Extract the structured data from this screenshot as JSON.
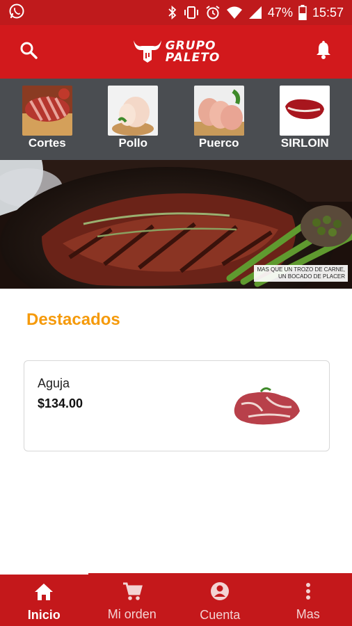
{
  "status_bar": {
    "battery": "47%",
    "time": "15:57",
    "icons": [
      "whatsapp-icon",
      "bluetooth-icon",
      "vibrate-icon",
      "alarm-icon",
      "wifi-icon",
      "signal-icon",
      "battery-icon"
    ]
  },
  "app_bar": {
    "logo_line1": "GRUPO",
    "logo_line2": "PALETO",
    "left_icon": "search-icon",
    "right_icon": "bell-icon"
  },
  "categories": [
    {
      "label": "Cortes"
    },
    {
      "label": "Pollo"
    },
    {
      "label": "Puerco"
    },
    {
      "label": "SIRLOIN"
    }
  ],
  "banner": {
    "caption_line1": "MAS QUE UN TROZO DE CARNE,",
    "caption_line2": "UN BOCADO DE PLACER"
  },
  "featured": {
    "title": "Destacados",
    "items": [
      {
        "name": "Aguja",
        "price": "$134.00"
      }
    ]
  },
  "bottom_nav": {
    "items": [
      {
        "label": "Inicio",
        "icon": "home-icon",
        "active": true
      },
      {
        "label": "Mi orden",
        "icon": "cart-icon",
        "active": false
      },
      {
        "label": "Cuenta",
        "icon": "account-icon",
        "active": false
      },
      {
        "label": "Mas",
        "icon": "more-vert-icon",
        "active": false
      }
    ]
  },
  "colors": {
    "status_bar": "#bf1a1c",
    "app_bar": "#d2191c",
    "categories_bg": "#4a4d51",
    "accent": "#f59a0b",
    "bottom_nav": "#c4181b"
  }
}
